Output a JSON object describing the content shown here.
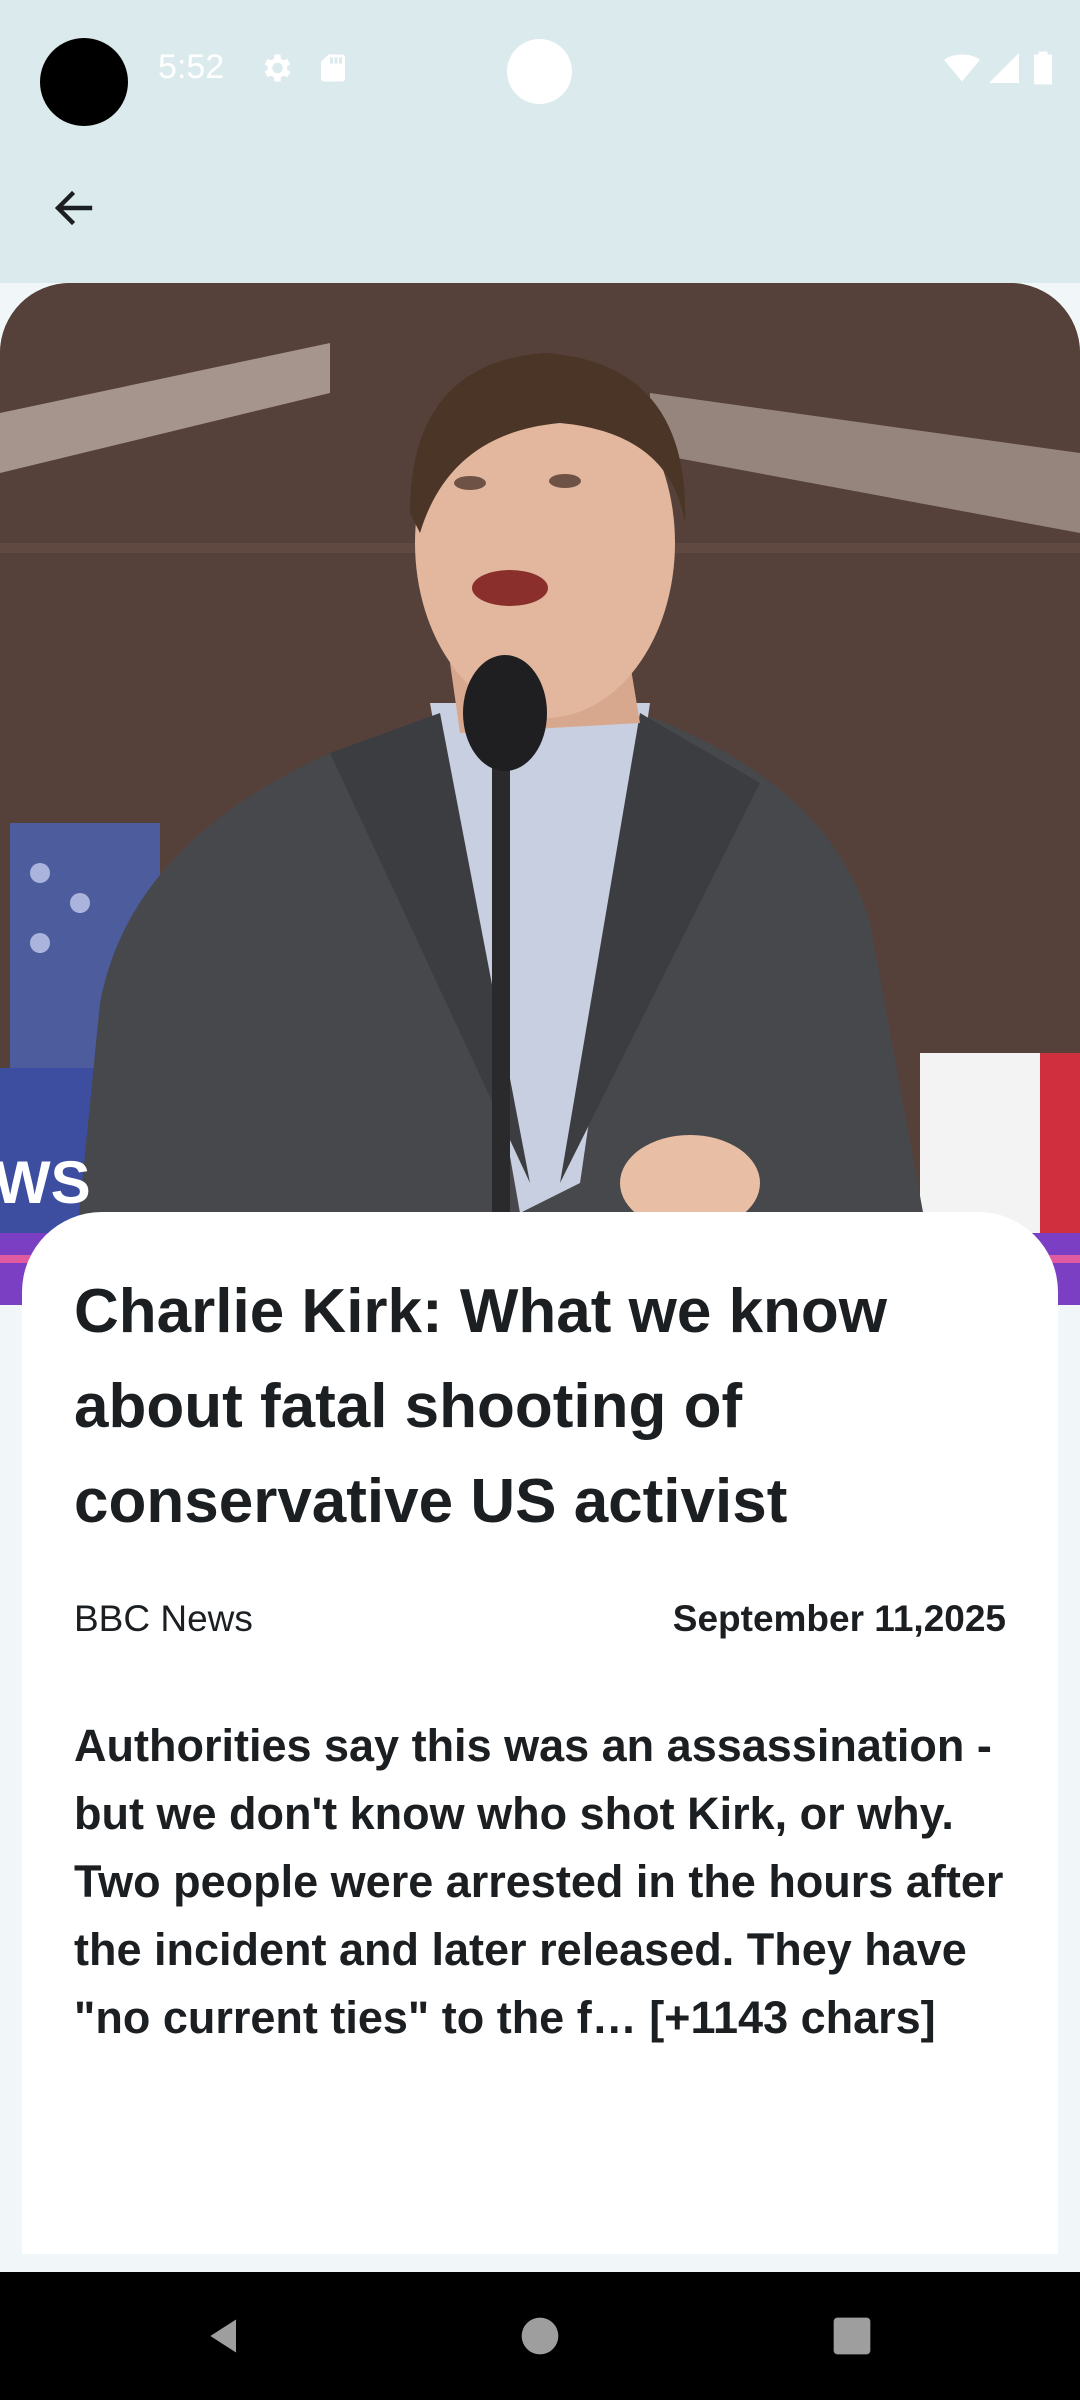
{
  "status_bar": {
    "time": "5:52",
    "icons": [
      "gear-icon",
      "sd-card-icon",
      "wifi-icon",
      "signal-icon",
      "battery-icon"
    ]
  },
  "app_bar": {
    "back_icon": "arrow-left-icon"
  },
  "hero": {
    "alt": "Man in a grey suit speaking at a microphone",
    "banner_text": "WS"
  },
  "article": {
    "title": "Charlie Kirk: What we know about fatal shooting of conservative US activist",
    "source": "BBC News",
    "date": "September 11,2025",
    "content": "Authorities say this was an assassination - but we don't know who shot Kirk, or why. Two people were arrested in the hours after the incident and later released. They have \"no current ties\" to the f… [+1143 chars]"
  },
  "nav_bar": {
    "icons": [
      "back-triangle-icon",
      "home-circle-icon",
      "recents-square-icon"
    ]
  },
  "colors": {
    "top_area": "#dbeaec",
    "page_bg": "#f1f7f8",
    "card_bg": "#ffffff",
    "text": "#1b1f22"
  }
}
